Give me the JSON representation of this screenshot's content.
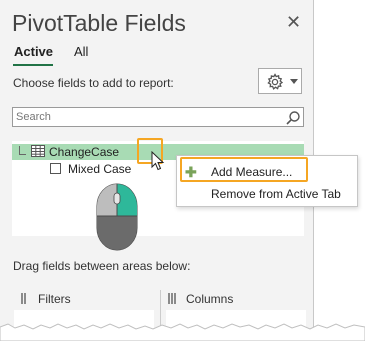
{
  "panel": {
    "title": "PivotTable Fields",
    "close_icon": "close-icon",
    "tabs": [
      {
        "label": "Active",
        "selected": true
      },
      {
        "label": "All",
        "selected": false
      }
    ],
    "choose_label": "Choose fields to add to report:",
    "settings_icon": "gear-icon",
    "search": {
      "placeholder": "Search",
      "icon": "search-icon"
    },
    "tables": [
      {
        "name": "ChangeCase",
        "icon": "table-icon",
        "fields": [
          {
            "name": "Mixed Case",
            "checked": false
          }
        ]
      }
    ],
    "drag_label": "Drag fields between areas below:",
    "areas": [
      {
        "label": "Filters",
        "icon": "filter-icon"
      },
      {
        "label": "Columns",
        "icon": "columns-icon"
      }
    ]
  },
  "context_menu": {
    "items": [
      {
        "label": "Add Measure...",
        "icon": "plus-icon"
      },
      {
        "label": "Remove from Active Tab"
      }
    ]
  },
  "colors": {
    "accent_green": "#217346",
    "highlight_row": "#a8dbb4",
    "callout_orange": "#f5a623",
    "mouse_button": "#2eb89a"
  },
  "annotation": {
    "mouse_graphic": "mouse-right-click-icon"
  }
}
